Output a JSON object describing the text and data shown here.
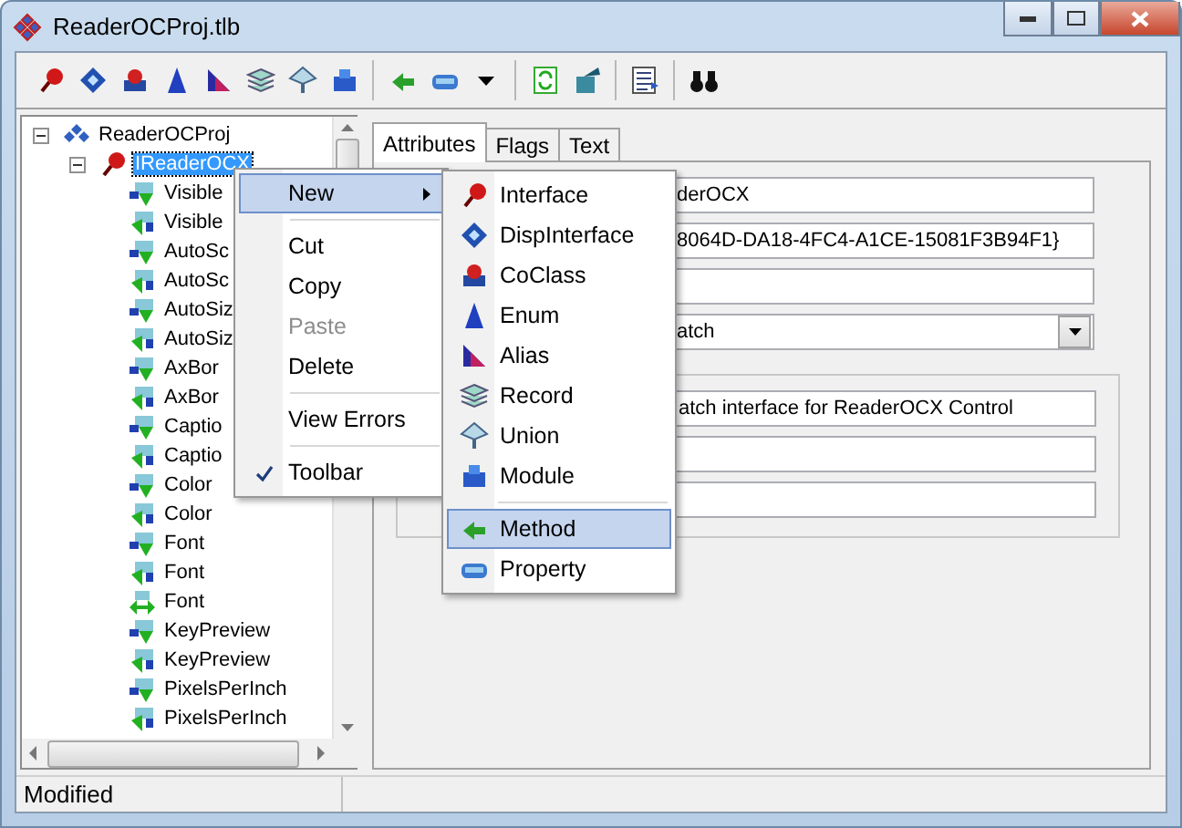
{
  "window": {
    "title": "ReaderOCProj.tlb"
  },
  "tree": {
    "label": "ReaderOCProj",
    "selected": false,
    "expanded": true,
    "children": [
      {
        "label": "IReaderOCX",
        "selected": true,
        "expanded": true,
        "children": [
          {
            "label": "Visible",
            "kind": "propget",
            "selected": false
          },
          {
            "label": "Visible",
            "kind": "propput",
            "selected": false
          },
          {
            "label": "AutoSc",
            "kind": "propget",
            "selected": false
          },
          {
            "label": "AutoSc",
            "kind": "propput",
            "selected": false
          },
          {
            "label": "AutoSiz",
            "kind": "propget",
            "selected": false
          },
          {
            "label": "AutoSiz",
            "kind": "propput",
            "selected": false
          },
          {
            "label": "AxBor",
            "kind": "propget",
            "selected": false
          },
          {
            "label": "AxBor",
            "kind": "propput",
            "selected": false
          },
          {
            "label": "Captio",
            "kind": "propget",
            "selected": false
          },
          {
            "label": "Captio",
            "kind": "propput",
            "selected": false
          },
          {
            "label": "Color",
            "kind": "propget",
            "selected": false
          },
          {
            "label": "Color",
            "kind": "propput",
            "selected": false
          },
          {
            "label": "Font",
            "kind": "propget",
            "selected": false
          },
          {
            "label": "Font",
            "kind": "propput",
            "selected": false
          },
          {
            "label": "Font",
            "kind": "propputref",
            "selected": false
          },
          {
            "label": "KeyPreview",
            "kind": "propget",
            "selected": false
          },
          {
            "label": "KeyPreview",
            "kind": "propput",
            "selected": false
          },
          {
            "label": "PixelsPerInch",
            "kind": "propget",
            "selected": false
          },
          {
            "label": "PixelsPerInch",
            "kind": "propput",
            "selected": false
          }
        ]
      }
    ]
  },
  "tabs": [
    {
      "label": "Attributes",
      "selected": true
    },
    {
      "label": "Flags",
      "selected": false
    },
    {
      "label": "Text",
      "selected": false
    }
  ],
  "fields": [
    {
      "kind": "text",
      "value": "derOCX"
    },
    {
      "kind": "text",
      "value": "8064D-DA18-4FC4-A1CE-15081F3B94F1}"
    },
    {
      "kind": "text"
    },
    {
      "kind": "dropdown",
      "value": "atch"
    }
  ],
  "group_fields": [
    {
      "kind": "text",
      "value": "atch interface for ReaderOCX Control"
    },
    {
      "kind": "text"
    },
    {
      "kind": "text"
    }
  ],
  "context_menu": [
    {
      "kind": "item",
      "label": "New",
      "selected": true,
      "disabled": false,
      "checked": false,
      "submenu": true
    },
    {
      "kind": "separator"
    },
    {
      "kind": "item",
      "label": "Cut",
      "selected": false,
      "disabled": false,
      "checked": false,
      "submenu": false
    },
    {
      "kind": "item",
      "label": "Copy",
      "selected": false,
      "disabled": false,
      "checked": false,
      "submenu": false
    },
    {
      "kind": "item",
      "label": "Paste",
      "selected": false,
      "disabled": true,
      "checked": false,
      "submenu": false
    },
    {
      "kind": "item",
      "label": "Delete",
      "selected": false,
      "disabled": false,
      "checked": false,
      "submenu": false
    },
    {
      "kind": "separator"
    },
    {
      "kind": "item",
      "label": "View Errors",
      "selected": false,
      "disabled": false,
      "checked": false,
      "submenu": false
    },
    {
      "kind": "separator"
    },
    {
      "kind": "item",
      "label": "Toolbar",
      "selected": false,
      "disabled": false,
      "checked": true,
      "submenu": false
    }
  ],
  "submenu": [
    {
      "kind": "interface",
      "label": "Interface",
      "selected": false
    },
    {
      "kind": "dispinterface",
      "label": "DispInterface",
      "selected": false
    },
    {
      "kind": "coclass",
      "label": "CoClass",
      "selected": false
    },
    {
      "kind": "enum",
      "label": "Enum",
      "selected": false
    },
    {
      "kind": "alias",
      "label": "Alias",
      "selected": false
    },
    {
      "kind": "record",
      "label": "Record",
      "selected": false
    },
    {
      "kind": "union",
      "label": "Union",
      "selected": false
    },
    {
      "kind": "module",
      "label": "Module",
      "selected": false
    },
    {
      "kind": "separator"
    },
    {
      "kind": "method",
      "label": "Method",
      "selected": true
    },
    {
      "kind": "property",
      "label": "Property",
      "selected": false
    }
  ],
  "status_bar": {
    "text": "Modified"
  }
}
